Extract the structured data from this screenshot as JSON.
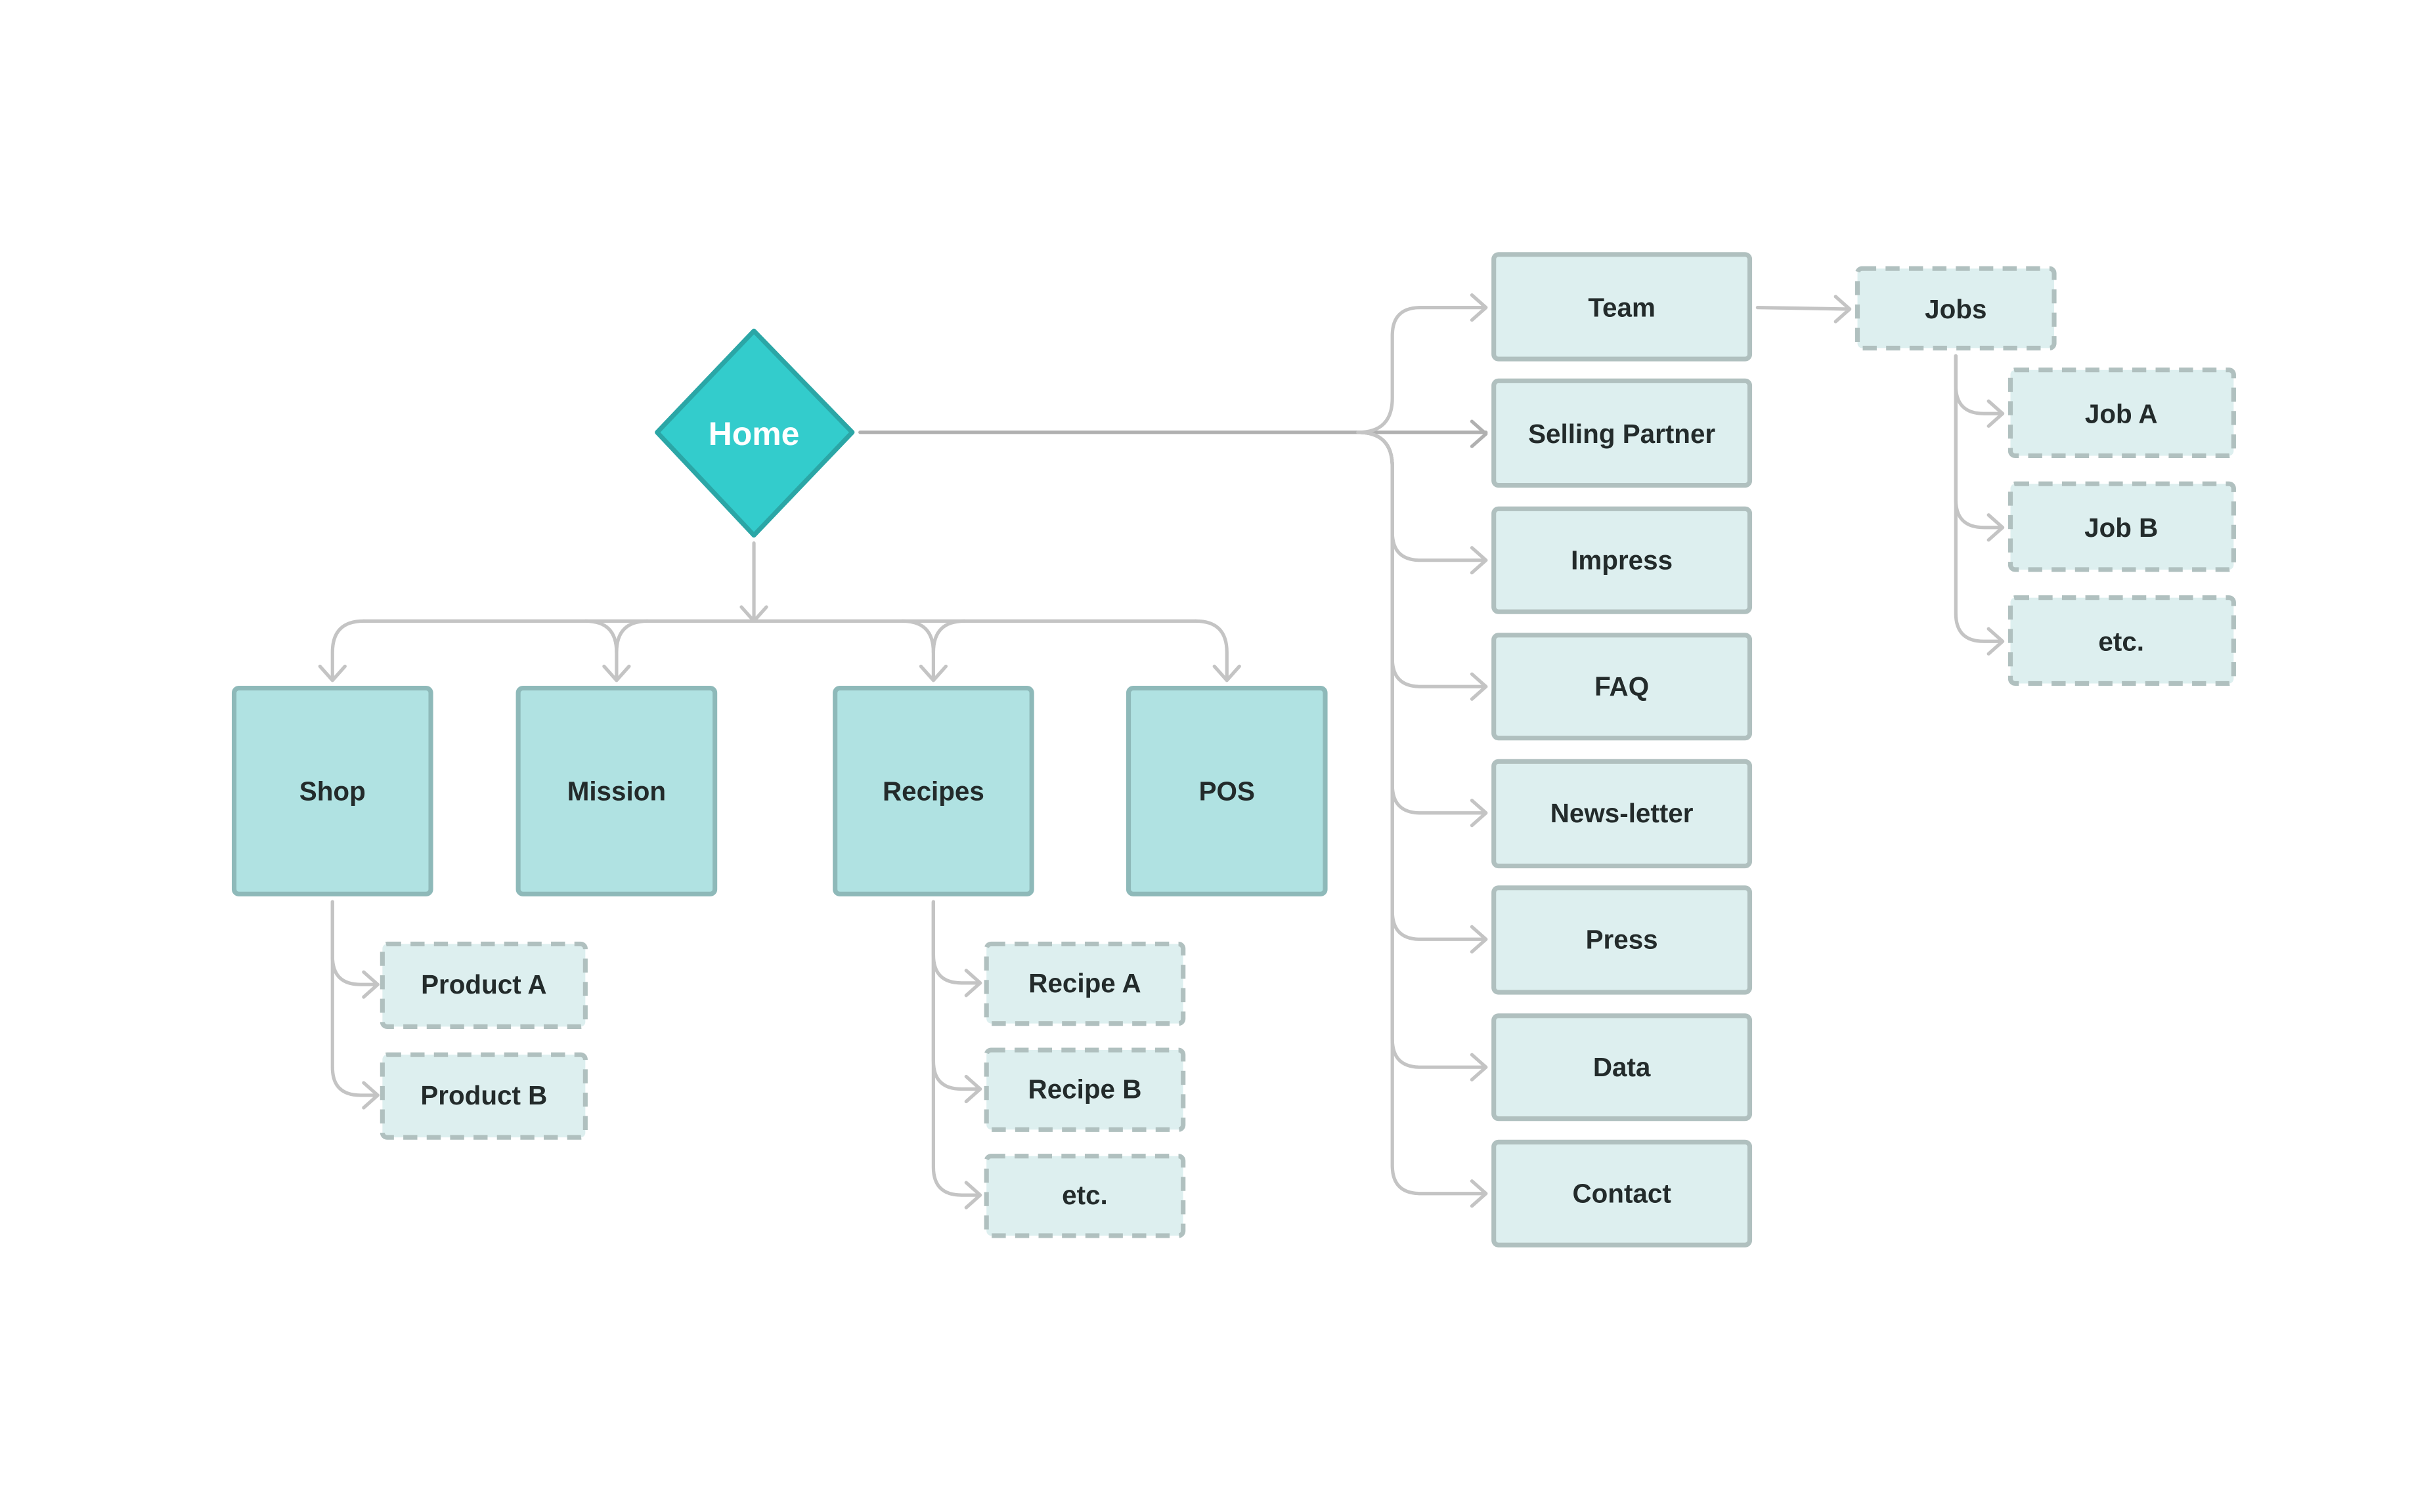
{
  "root": {
    "label": "Home"
  },
  "main_sections": [
    {
      "label": "Shop",
      "children": [
        "Product A",
        "Product B"
      ]
    },
    {
      "label": "Mission",
      "children": []
    },
    {
      "label": "Recipes",
      "children": [
        "Recipe A",
        "Recipe B",
        "etc."
      ]
    },
    {
      "label": "POS",
      "children": []
    }
  ],
  "side_pages": [
    {
      "label": "Team"
    },
    {
      "label": "Selling Partner"
    },
    {
      "label": "Impress"
    },
    {
      "label": "FAQ"
    },
    {
      "label": "News-letter"
    },
    {
      "label": "Press"
    },
    {
      "label": "Data"
    },
    {
      "label": "Contact"
    }
  ],
  "jobs": {
    "label": "Jobs",
    "children": [
      "Job A",
      "Job B",
      "etc."
    ]
  },
  "colors": {
    "root_fill": "#33cccc",
    "root_stroke": "#2ba6a6",
    "main_fill": "#b0e2e2",
    "main_stroke": "#8eb9b9",
    "sub_fill": "#ddefef",
    "sub_stroke": "#b0c0bf",
    "connector": "#c4c4c4",
    "text": "#232b2b"
  }
}
